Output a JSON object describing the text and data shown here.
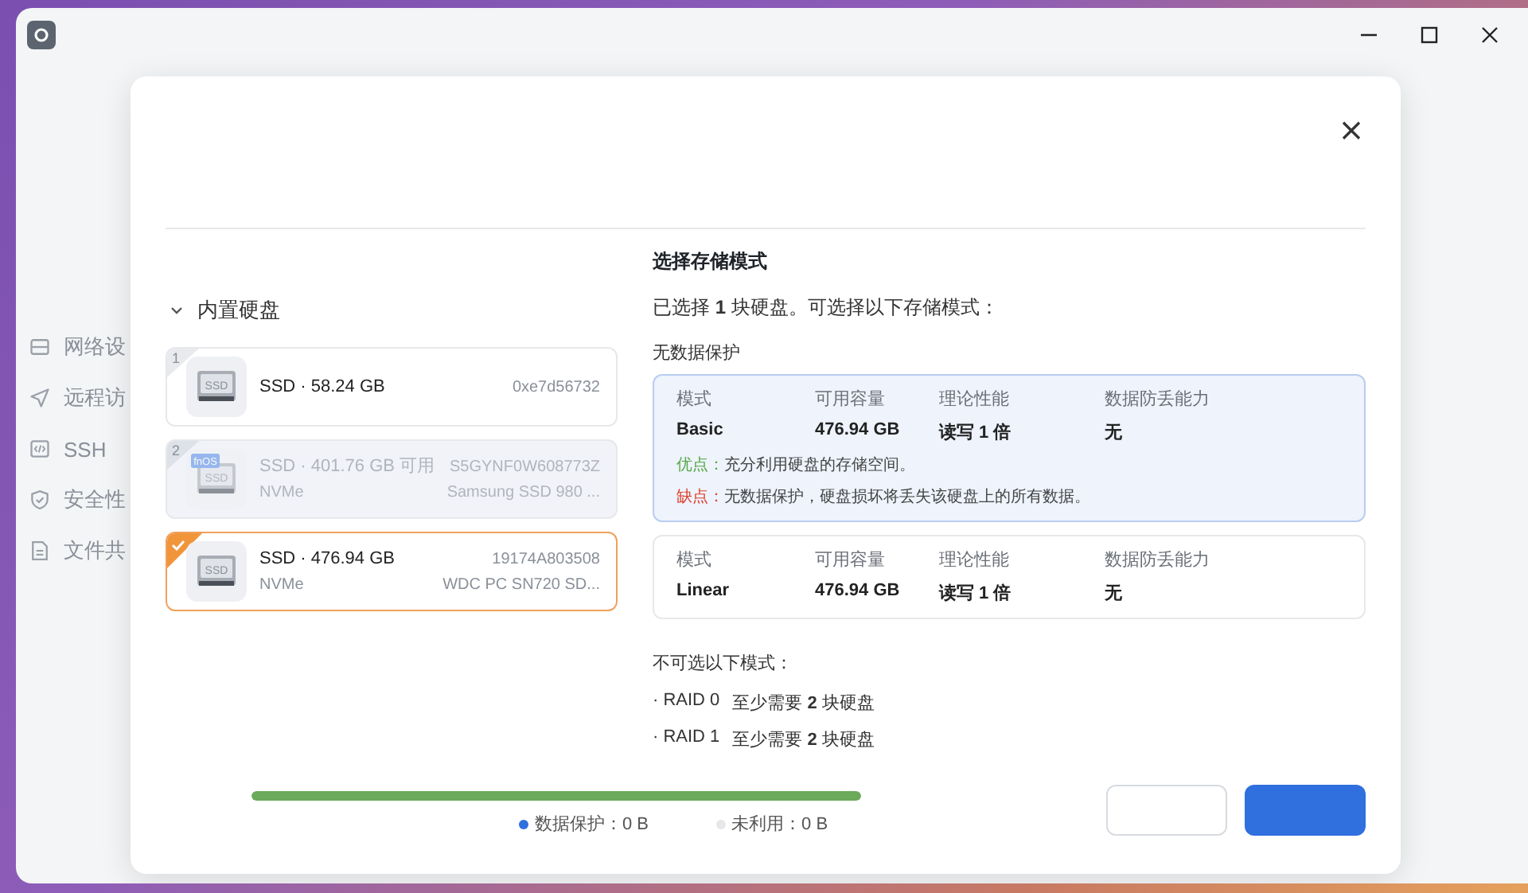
{
  "sidebar": {
    "items": [
      {
        "label": "网络设"
      },
      {
        "label": "远程访"
      },
      {
        "label": "SSH"
      },
      {
        "label": "安全性"
      },
      {
        "label": "文件共"
      }
    ]
  },
  "dialog": {
    "disk_group": {
      "title": "内置硬盘",
      "expanded": true,
      "disks": [
        {
          "number": "1",
          "icon_label": "SSD",
          "title": "SSD · 58.24 GB",
          "serial": "0xe7d56732",
          "selected": false,
          "disabled": false
        },
        {
          "number": "2",
          "icon_label": "SSD",
          "badge": "fnOS",
          "title": "SSD · 401.76 GB 可用",
          "interface": "NVMe",
          "serial": "S5GYNF0W608773Z",
          "model": "Samsung SSD 980 ...",
          "selected": false,
          "disabled": true
        },
        {
          "icon_label": "SSD",
          "title": "SSD · 476.94 GB",
          "interface": "NVMe",
          "serial": "19174A803508",
          "model": "WDC PC SN720 SD...",
          "selected": true,
          "disabled": false
        }
      ]
    },
    "title": "选择存储模式",
    "summary": "已选择 **1** 块硬盘。可选择以下存储模式：",
    "section": "无数据保护",
    "modes": [
      {
        "selected": true,
        "fields": [
          {
            "label": "模式",
            "value": "Basic"
          },
          {
            "label": "可用容量",
            "value": "476.94 GB"
          },
          {
            "label": "理论性能",
            "value": "读写 1 倍"
          },
          {
            "label": "数据防丢能力",
            "value": "无"
          }
        ],
        "notes": [
          {
            "kind": "pro",
            "label": "优点：",
            "text": "充分利用硬盘的存储空间。"
          },
          {
            "kind": "con",
            "label": "缺点：",
            "text": "无数据保护，硬盘损坏将丢失该硬盘上的所有数据。"
          }
        ]
      },
      {
        "selected": false,
        "fields": [
          {
            "label": "模式",
            "value": "Linear"
          },
          {
            "label": "可用容量",
            "value": "476.94 GB"
          },
          {
            "label": "理论性能",
            "value": "读写 1 倍"
          },
          {
            "label": "数据防丢能力",
            "value": "无"
          }
        ]
      }
    ],
    "unavailable_title": "不可选以下模式：",
    "unavailable": [
      {
        "mode": "· RAID 0",
        "reason": "至少需要 **2** 块硬盘"
      },
      {
        "mode": "· RAID 1",
        "reason": "至少需要 **2** 块硬盘"
      }
    ],
    "usage": {
      "level": 1,
      "legend": [
        {
          "color": "#2f6fde",
          "label": "数据保护：0 B"
        },
        {
          "color": "#e5e7eb",
          "label": "未利用：0 B"
        }
      ]
    }
  }
}
